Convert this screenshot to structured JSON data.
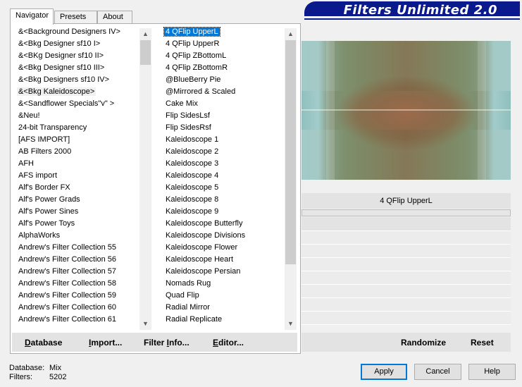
{
  "tabs": [
    {
      "label": "Navigator"
    },
    {
      "label": "Presets"
    },
    {
      "label": "About"
    }
  ],
  "title": "Filters Unlimited 2.0",
  "categories": [
    "&<Background Designers IV>",
    "&<Bkg Designer sf10 I>",
    "&<BKg Designer sf10 II>",
    "&<Bkg Designer sf10 III>",
    "&<Bkg Designers sf10 IV>",
    "&<Bkg Kaleidoscope>",
    "&<Sandflower Specials\"v\" >",
    "&Neu!",
    "24-bit Transparency",
    "[AFS IMPORT]",
    "AB Filters 2000",
    "AFH",
    "AFS import",
    "Alf's Border FX",
    "Alf's Power Grads",
    "Alf's Power Sines",
    "Alf's Power Toys",
    "AlphaWorks",
    "Andrew's Filter Collection 55",
    "Andrew's Filter Collection 56",
    "Andrew's Filter Collection 57",
    "Andrew's Filter Collection 58",
    "Andrew's Filter Collection 59",
    "Andrew's Filter Collection 60",
    "Andrew's Filter Collection 61"
  ],
  "highlighted_category_index": 5,
  "filters": [
    "4 QFlip UpperL",
    "4 QFlip UpperR",
    "4 QFlip ZBottomL",
    "4 QFlip ZBottomR",
    "@BlueBerry Pie",
    "@Mirrored & Scaled",
    "Cake Mix",
    "Flip SidesLsf",
    "Flip SidesRsf",
    "Kaleidoscope 1",
    "Kaleidoscope 2",
    "Kaleidoscope 3",
    "Kaleidoscope 4",
    "Kaleidoscope 5",
    "Kaleidoscope 8",
    "Kaleidoscope 9",
    "Kaleidoscope Butterfly",
    "Kaleidoscope Divisions",
    "Kaleidoscope Flower",
    "Kaleidoscope Heart",
    "Kaleidoscope Persian",
    "Nomads Rug",
    "Quad Flip",
    "Radial Mirror",
    "Radial Replicate"
  ],
  "selected_filter_index": 0,
  "selected_filter_name": "4 QFlip UpperL",
  "bottom_buttons": {
    "database_pre": "D",
    "database_post": "atabase",
    "import_pre": "I",
    "import_post": "mport...",
    "filter_info_pre": "Filter ",
    "filter_info_u": "I",
    "filter_info_post": "nfo...",
    "editor_pre": "E",
    "editor_post": "ditor..."
  },
  "randomize_label": "Randomize",
  "reset_label": "Reset",
  "footer": {
    "database_label": "Database:",
    "database_value": "Mix",
    "filters_label": "Filters:",
    "filters_value": "5202"
  },
  "apply_label": "Apply",
  "cancel_label": "Cancel",
  "help_label": "Help",
  "icons": {
    "scroll_up": "up-arrow-icon",
    "scroll_down": "down-arrow-icon"
  },
  "colors": {
    "banner": "#0a1a8c",
    "selection": "#0078d7"
  }
}
